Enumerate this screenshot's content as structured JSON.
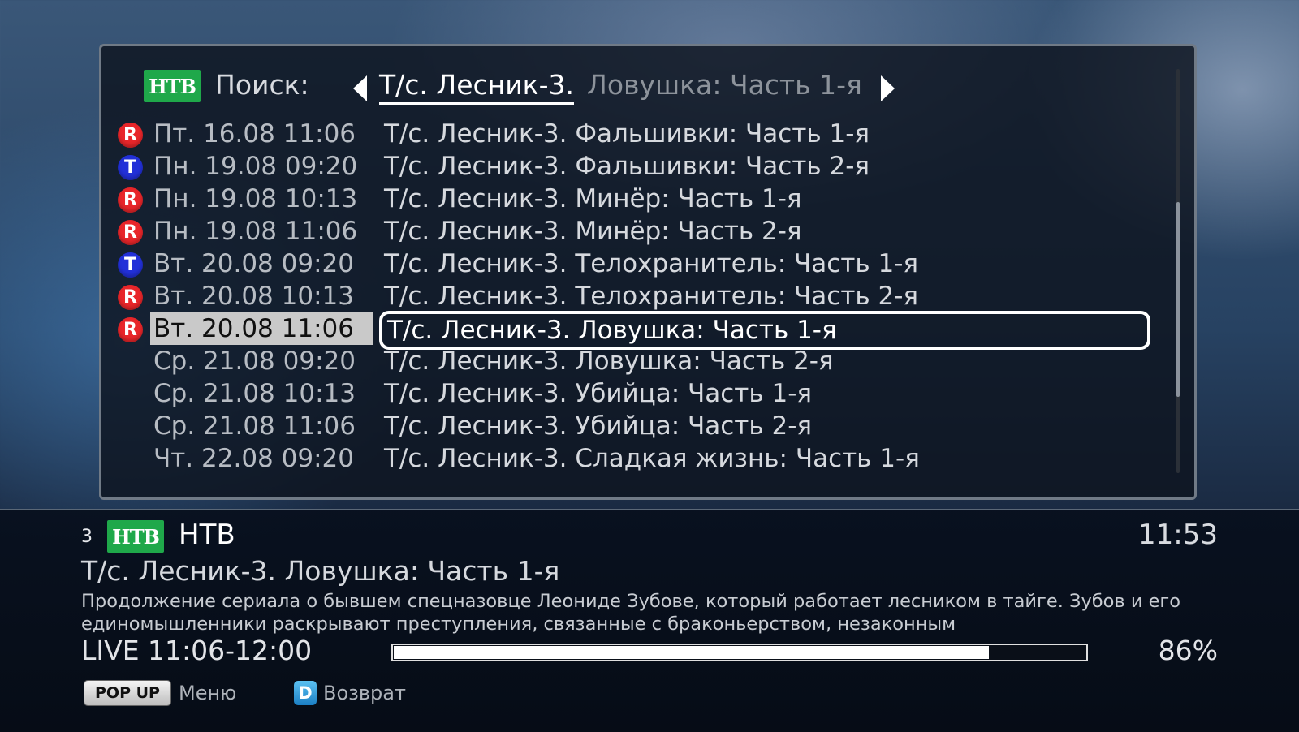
{
  "search": {
    "channel_logo": "НТВ",
    "label": "Поиск:",
    "query_current": "Т/с. Лесник-3.",
    "query_rest": "Ловушка: Часть 1-я"
  },
  "listings": [
    {
      "flag": "R",
      "date": "Пт. 16.08 11:06",
      "title": "Т/с. Лесник-3. Фальшивки: Часть 1-я"
    },
    {
      "flag": "T",
      "date": "Пн. 19.08 09:20",
      "title": "Т/с. Лесник-3. Фальшивки: Часть 2-я"
    },
    {
      "flag": "R",
      "date": "Пн. 19.08 10:13",
      "title": "Т/с. Лесник-3. Минёр: Часть 1-я"
    },
    {
      "flag": "R",
      "date": "Пн. 19.08 11:06",
      "title": "Т/с. Лесник-3. Минёр: Часть 2-я"
    },
    {
      "flag": "T",
      "date": "Вт. 20.08 09:20",
      "title": "Т/с. Лесник-3. Телохранитель: Часть 1-я"
    },
    {
      "flag": "R",
      "date": "Вт. 20.08 10:13",
      "title": "Т/с. Лесник-3. Телохранитель: Часть 2-я"
    },
    {
      "flag": "R",
      "date": "Вт. 20.08 11:06",
      "title": "Т/с. Лесник-3. Ловушка: Часть 1-я"
    },
    {
      "flag": "",
      "date": "Ср. 21.08 09:20",
      "title": "Т/с. Лесник-3. Ловушка: Часть 2-я"
    },
    {
      "flag": "",
      "date": "Ср. 21.08 10:13",
      "title": "Т/с. Лесник-3. Убийца: Часть 1-я"
    },
    {
      "flag": "",
      "date": "Ср. 21.08 11:06",
      "title": "Т/с. Лесник-3. Убийца: Часть 2-я"
    },
    {
      "flag": "",
      "date": "Чт. 22.08 09:20",
      "title": "Т/с. Лесник-3. Сладкая жизнь: Часть 1-я"
    }
  ],
  "info": {
    "channel_number": "3",
    "channel_logo": "НТВ",
    "channel_name": "НТВ",
    "clock": "11:53",
    "program_title": "Т/с. Лесник-3. Ловушка: Часть 1-я",
    "description_line1": "Продолжение сериала о бывшем спецназовце Леониде Зубове, который работает лесником в тайге. Зубов и его",
    "description_line2": "единомышленники раскрывают преступления, связанные с браконьерством, незаконным",
    "live_time": "LIVE 11:06-12:00",
    "progress": 0.86,
    "progress_text": "86%"
  },
  "footer": {
    "popup_button": "POP UP",
    "popup_label": "Меню",
    "d_button": "D",
    "d_label": "Возврат"
  },
  "colors": {
    "record_badge": "#e8262a",
    "timer_badge": "#2230d8",
    "channel_logo_bg": "#1fa84a"
  }
}
